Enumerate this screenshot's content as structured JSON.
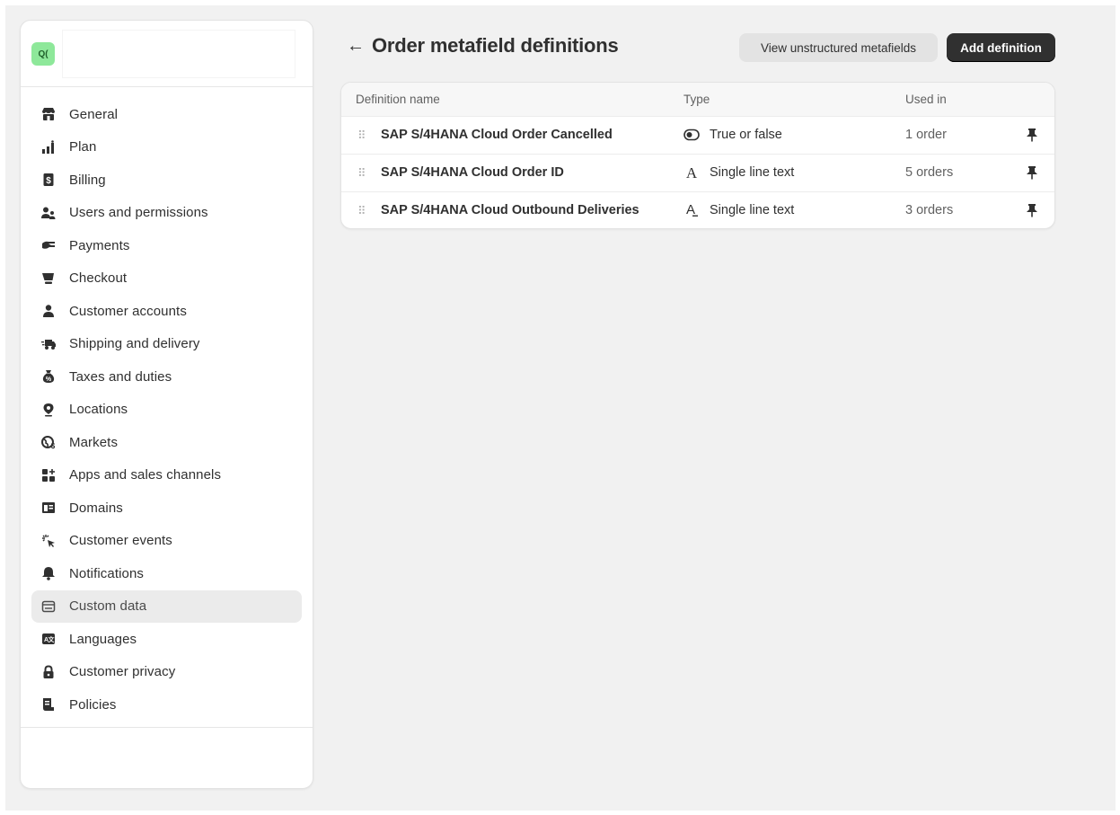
{
  "store": {
    "avatar_initials": "Q("
  },
  "sidebar": {
    "items": [
      {
        "label": "General",
        "icon": "store-icon"
      },
      {
        "label": "Plan",
        "icon": "plan-icon"
      },
      {
        "label": "Billing",
        "icon": "billing-icon"
      },
      {
        "label": "Users and permissions",
        "icon": "users-icon"
      },
      {
        "label": "Payments",
        "icon": "payments-icon"
      },
      {
        "label": "Checkout",
        "icon": "cart-icon"
      },
      {
        "label": "Customer accounts",
        "icon": "person-icon"
      },
      {
        "label": "Shipping and delivery",
        "icon": "truck-icon"
      },
      {
        "label": "Taxes and duties",
        "icon": "tax-bag-icon"
      },
      {
        "label": "Locations",
        "icon": "location-pin-icon"
      },
      {
        "label": "Markets",
        "icon": "globe-icon"
      },
      {
        "label": "Apps and sales channels",
        "icon": "apps-icon"
      },
      {
        "label": "Domains",
        "icon": "domains-icon"
      },
      {
        "label": "Customer events",
        "icon": "cursor-click-icon"
      },
      {
        "label": "Notifications",
        "icon": "bell-icon"
      },
      {
        "label": "Custom data",
        "icon": "database-icon",
        "active": true
      },
      {
        "label": "Languages",
        "icon": "language-icon"
      },
      {
        "label": "Customer privacy",
        "icon": "lock-icon"
      },
      {
        "label": "Policies",
        "icon": "policies-icon"
      }
    ]
  },
  "header": {
    "back_arrow": "←",
    "title": "Order metafield definitions",
    "secondary_button": "View unstructured metafields",
    "primary_button": "Add definition"
  },
  "table": {
    "columns": [
      "Definition name",
      "Type",
      "Used in"
    ],
    "rows": [
      {
        "name": "SAP S/4HANA Cloud Order Cancelled",
        "type_icon": "toggle-icon",
        "type": "True or false",
        "used_in": "1 order"
      },
      {
        "name": "SAP S/4HANA Cloud Order ID",
        "type_icon": "text-a-icon",
        "type": "Single line text",
        "used_in": "5 orders"
      },
      {
        "name": "SAP S/4HANA Cloud Outbound Deliveries",
        "type_icon": "text-a-underline-icon",
        "type": "Single line text",
        "used_in": "3 orders"
      }
    ]
  },
  "colors": {
    "page_bg": "#f1f1f1",
    "card_bg": "#ffffff",
    "primary_button_bg": "#303030",
    "secondary_button_bg": "#e3e3e3",
    "avatar_bg": "#8ee89a",
    "active_nav_bg": "#ebebeb"
  }
}
